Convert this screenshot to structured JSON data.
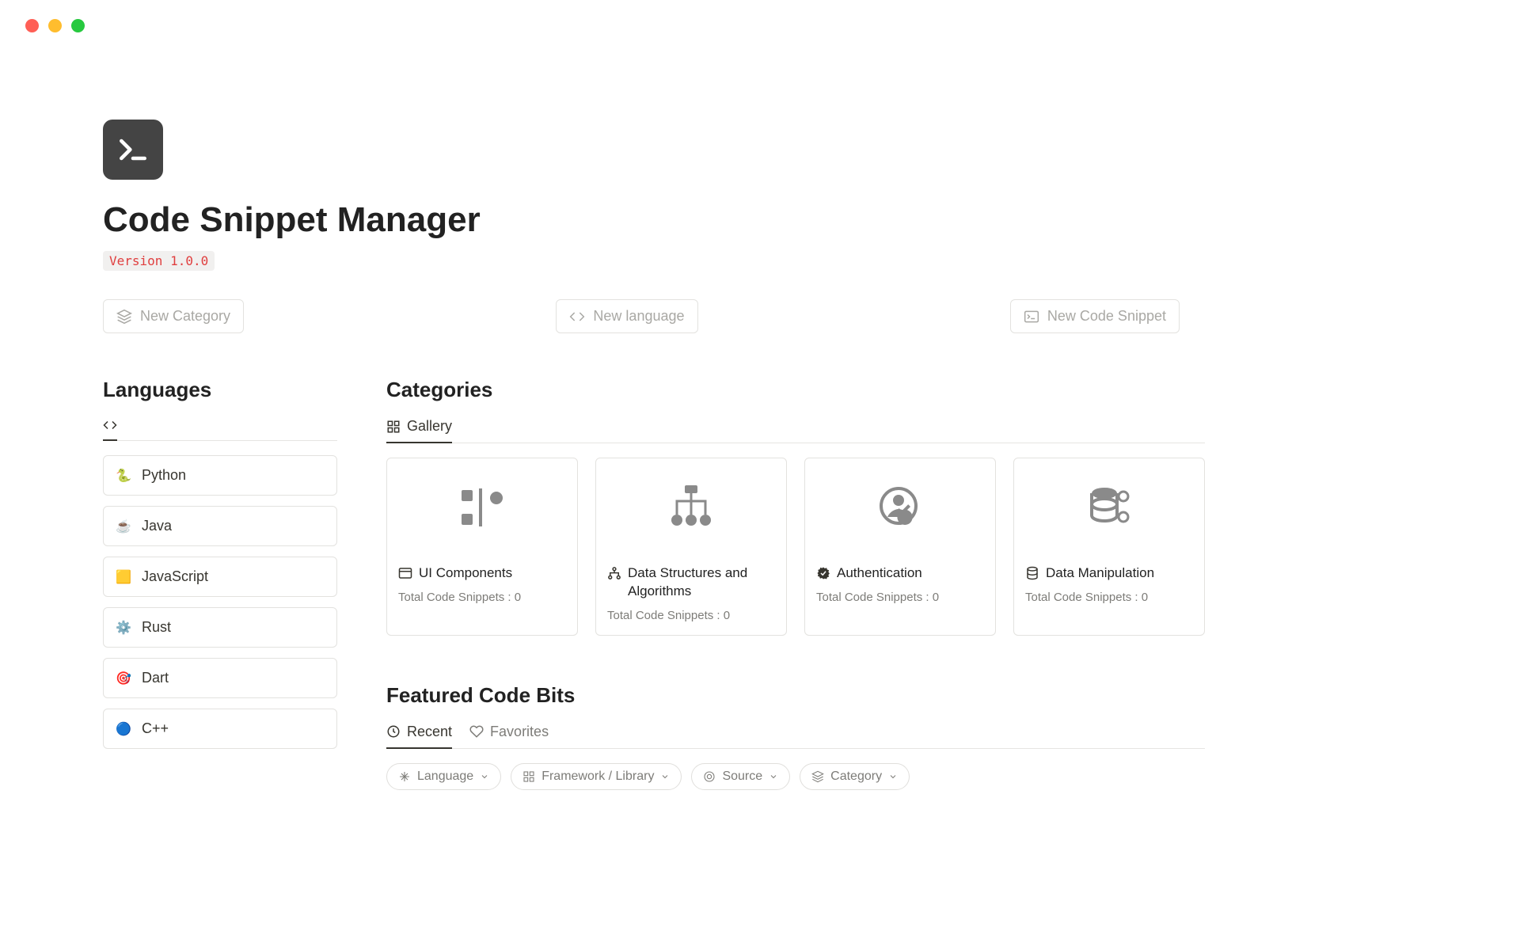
{
  "window": {
    "controls": [
      "close",
      "minimize",
      "maximize"
    ]
  },
  "header": {
    "icon_name": "terminal-icon",
    "title": "Code Snippet Manager",
    "version_label": "Version 1.0.0"
  },
  "actions": {
    "new_category": {
      "label": "New Category",
      "icon": "layers-icon"
    },
    "new_language": {
      "label": "New language",
      "icon": "code-icon"
    },
    "new_snippet": {
      "label": "New Code Snippet",
      "icon": "terminal-small-icon"
    }
  },
  "languages": {
    "title": "Languages",
    "tab_icon": "code-icon",
    "items": [
      {
        "emoji": "🐍",
        "name": "Python"
      },
      {
        "emoji": "☕",
        "name": "Java"
      },
      {
        "emoji": "🟨",
        "name": "JavaScript"
      },
      {
        "emoji": "⚙️",
        "name": "Rust"
      },
      {
        "emoji": "🎯",
        "name": "Dart"
      },
      {
        "emoji": "🔵",
        "name": "C++"
      }
    ]
  },
  "categories": {
    "title": "Categories",
    "tabs": [
      {
        "label": "Gallery",
        "icon": "gallery-icon",
        "active": true
      }
    ],
    "snippet_count_label": "Total Code Snippets : 0",
    "cards": [
      {
        "title": "UI Components",
        "icon": "window-icon",
        "cover": "ui-components-cover"
      },
      {
        "title": "Data Structures and Algorithms",
        "icon": "hierarchy-icon",
        "cover": "algorithm-cover"
      },
      {
        "title": "Authentication",
        "icon": "verified-icon",
        "cover": "auth-cover"
      },
      {
        "title": "Data Manipulation",
        "icon": "database-icon",
        "cover": "data-cover"
      }
    ]
  },
  "featured": {
    "title": "Featured Code Bits",
    "tabs": [
      {
        "label": "Recent",
        "icon": "clock-icon",
        "active": true
      },
      {
        "label": "Favorites",
        "icon": "heart-icon",
        "active": false
      }
    ],
    "filters": [
      {
        "label": "Language",
        "icon": "sparkle-icon"
      },
      {
        "label": "Framework / Library",
        "icon": "grid-icon"
      },
      {
        "label": "Source",
        "icon": "target-icon"
      },
      {
        "label": "Category",
        "icon": "layers-icon"
      }
    ]
  }
}
